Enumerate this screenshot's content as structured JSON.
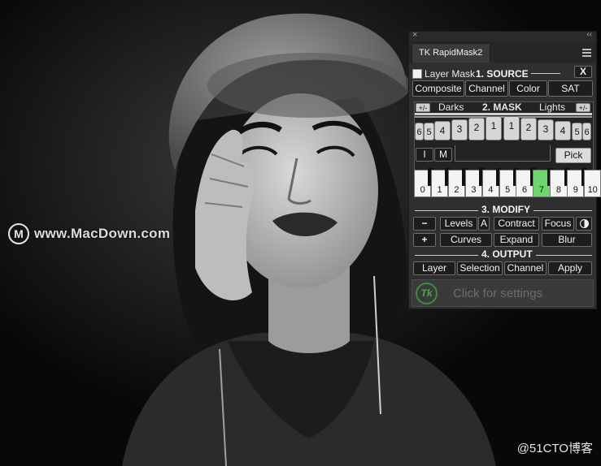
{
  "watermark": {
    "logo_letter": "M",
    "text": "www.MacDown.com"
  },
  "credit": "@51CTO博客",
  "panel": {
    "close_glyph": "×",
    "collapse_glyph": "‹‹",
    "tab_title": "TK RapidMask2",
    "menu_icon": "hamburger-menu-icon",
    "source": {
      "layer_mask_label": "Layer Mask",
      "layer_mask_checked": false,
      "heading": "1. SOURCE",
      "clear_label": "X",
      "buttons": [
        "Composite",
        "Channel",
        "Color",
        "SAT"
      ]
    },
    "mask": {
      "darks_toggle": "+/-",
      "darks_label": "Darks",
      "heading": "2. MASK",
      "lights_label": "Lights",
      "lights_toggle": "+/-",
      "dark_levels": [
        "6",
        "5",
        "4",
        "3",
        "2",
        "1"
      ],
      "light_levels": [
        "1",
        "2",
        "3",
        "4",
        "5",
        "6"
      ],
      "i_label": "I",
      "m_label": "M",
      "pick_label": "Pick",
      "zones": [
        "0",
        "1",
        "2",
        "3",
        "4",
        "5",
        "6",
        "7",
        "8",
        "9",
        "10"
      ],
      "selected_zone": "7"
    },
    "modify": {
      "heading": "3. MODIFY",
      "minus_label": "−",
      "plus_label": "+",
      "levels_label": "Levels",
      "auto_label": "A",
      "contract_label": "Contract",
      "focus_label": "Focus",
      "contrast_icon": "half-circle-icon",
      "curves_label": "Curves",
      "expand_label": "Expand",
      "blur_label": "Blur"
    },
    "output": {
      "heading": "4. OUTPUT",
      "buttons": [
        "Layer",
        "Selection",
        "Channel",
        "Apply"
      ]
    },
    "footer": {
      "logo_text": "Tk",
      "settings_label": "Click for settings"
    }
  }
}
